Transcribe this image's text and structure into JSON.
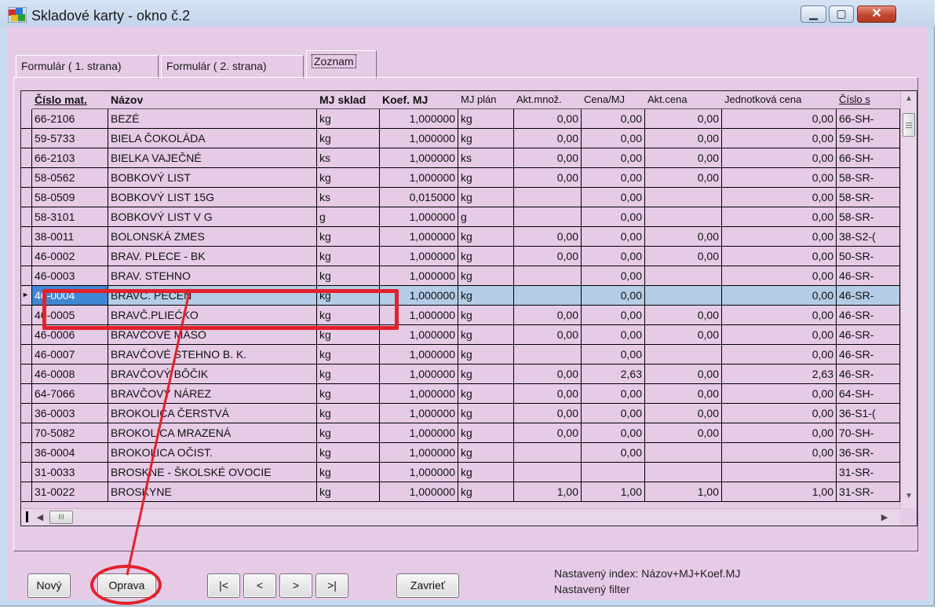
{
  "window": {
    "title": "Skladové karty - okno č.2",
    "controls": {
      "minimize": "▁",
      "maximize": "▢",
      "close": "✕"
    }
  },
  "tabs": [
    {
      "label": "Formulár ( 1. strana)",
      "active": false
    },
    {
      "label": "Formulár ( 2. strana)",
      "active": false
    },
    {
      "label": "Zoznam",
      "active": true
    }
  ],
  "grid": {
    "headers": [
      "Číslo mat.",
      "Názov",
      "MJ sklad",
      "Koef. MJ",
      "MJ plán",
      "Akt.množ.",
      "Cena/MJ",
      "Akt.cena",
      "Jednotková cena",
      "Číslo s"
    ],
    "rows": [
      [
        "66-2106",
        "BEZÉ",
        "kg",
        "1,000000",
        "kg",
        "0,00",
        "0,00",
        "0,00",
        "0,00",
        "66-SH-"
      ],
      [
        "59-5733",
        "BIELA ČOKOLÁDA",
        "kg",
        "1,000000",
        "kg",
        "0,00",
        "0,00",
        "0,00",
        "0,00",
        "59-SH-"
      ],
      [
        "66-2103",
        "BIELKA VAJEČNÉ",
        "ks",
        "1,000000",
        "ks",
        "0,00",
        "0,00",
        "0,00",
        "0,00",
        "66-SH-"
      ],
      [
        "58-0562",
        "BOBKOVÝ LIST",
        "kg",
        "1,000000",
        "kg",
        "0,00",
        "0,00",
        "0,00",
        "0,00",
        "58-SR-"
      ],
      [
        "58-0509",
        "BOBKOVÝ LIST 15G",
        "ks",
        "0,015000",
        "kg",
        "",
        "0,00",
        "",
        "0,00",
        "58-SR-"
      ],
      [
        "58-3101",
        "BOBKOVÝ LIST V G",
        "g",
        "1,000000",
        "g",
        "",
        "0,00",
        "",
        "0,00",
        "58-SR-"
      ],
      [
        "38-0011",
        "BOLONSKÁ ZMES",
        "kg",
        "1,000000",
        "kg",
        "0,00",
        "0,00",
        "0,00",
        "0,00",
        "38-S2-("
      ],
      [
        "46-0002",
        "BRAV. PLECE - BK",
        "kg",
        "1,000000",
        "kg",
        "0,00",
        "0,00",
        "0,00",
        "0,00",
        "50-SR-"
      ],
      [
        "46-0003",
        "BRAV. STEHNO",
        "kg",
        "1,000000",
        "kg",
        "",
        "0,00",
        "",
        "0,00",
        "46-SR-"
      ],
      [
        "46-0004",
        "BRAVČ. PEČEŇ",
        "kg",
        "1,000000",
        "kg",
        "",
        "0,00",
        "",
        "0,00",
        "46-SR-"
      ],
      [
        "46-0005",
        "BRAVČ.PLIEĆKO",
        "kg",
        "1,000000",
        "kg",
        "0,00",
        "0,00",
        "0,00",
        "0,00",
        "46-SR-"
      ],
      [
        "46-0006",
        "BRAVČOVÉ MÄSO",
        "kg",
        "1,000000",
        "kg",
        "0,00",
        "0,00",
        "0,00",
        "0,00",
        "46-SR-"
      ],
      [
        "46-0007",
        "BRAVČOVÉ STEHNO B. K.",
        "kg",
        "1,000000",
        "kg",
        "",
        "0,00",
        "",
        "0,00",
        "46-SR-"
      ],
      [
        "46-0008",
        "BRAVČOVÝ BÔČIK",
        "kg",
        "1,000000",
        "kg",
        "0,00",
        "2,63",
        "0,00",
        "2,63",
        "46-SR-"
      ],
      [
        "64-7066",
        "BRAVČOVÝ NÁREZ",
        "kg",
        "1,000000",
        "kg",
        "0,00",
        "0,00",
        "0,00",
        "0,00",
        "64-SH-"
      ],
      [
        "36-0003",
        "BROKOLICA ČERSTVÁ",
        "kg",
        "1,000000",
        "kg",
        "0,00",
        "0,00",
        "0,00",
        "0,00",
        "36-S1-("
      ],
      [
        "70-5082",
        "BROKOLICA MRAZENÁ",
        "kg",
        "1,000000",
        "kg",
        "0,00",
        "0,00",
        "0,00",
        "0,00",
        "70-SH-"
      ],
      [
        "36-0004",
        "BROKOLICA OČIST.",
        "kg",
        "1,000000",
        "kg",
        "",
        "0,00",
        "",
        "0,00",
        "36-SR-"
      ],
      [
        "31-0033",
        "BROSKNE - ŠKOLSKÉ OVOCIE",
        "kg",
        "1,000000",
        "kg",
        "",
        "",
        "",
        "",
        "31-SR-"
      ],
      [
        "31-0022",
        "BROSKYNE",
        "kg",
        "1,000000",
        "kg",
        "1,00",
        "1,00",
        "1,00",
        "1,00",
        "31-SR-"
      ]
    ],
    "selected_row": 9
  },
  "scrollbar": {
    "thumb_label": "III"
  },
  "buttons": {
    "novy": "Nový",
    "oprava": "Oprava",
    "first": "|<",
    "prev": "<",
    "next": ">",
    "last": ">|",
    "zavriet": "Zavrieť"
  },
  "status": {
    "index": "Nastavený index: Názov+MJ+Koef.MJ",
    "filter": "Nastavený filter"
  },
  "colors": {
    "background": "#e6cbe7",
    "selection": "#b4cce6",
    "selection_key": "#3f86d4",
    "annotation": "#e3212b"
  }
}
